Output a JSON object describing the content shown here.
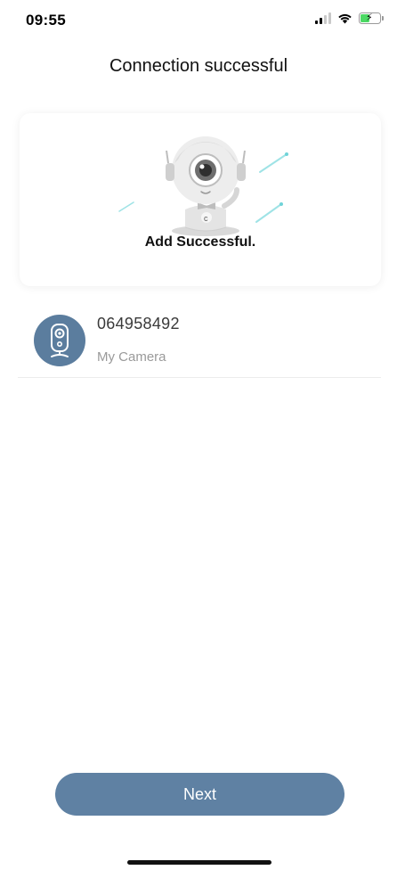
{
  "status_bar": {
    "time": "09:55",
    "icons": [
      "cellular-signal-icon",
      "wifi-icon",
      "battery-charging-icon"
    ]
  },
  "header": {
    "title": "Connection successful"
  },
  "success_card": {
    "illustration": "camera-mascot-illustration",
    "message": "Add Successful."
  },
  "device": {
    "icon": "security-camera-icon",
    "id": "064958492",
    "name": "My Camera"
  },
  "actions": {
    "next_label": "Next"
  },
  "colors": {
    "accent": "#5f81a3",
    "avatar_bg": "#5b7d9e",
    "battery_fill": "#4cd964"
  }
}
